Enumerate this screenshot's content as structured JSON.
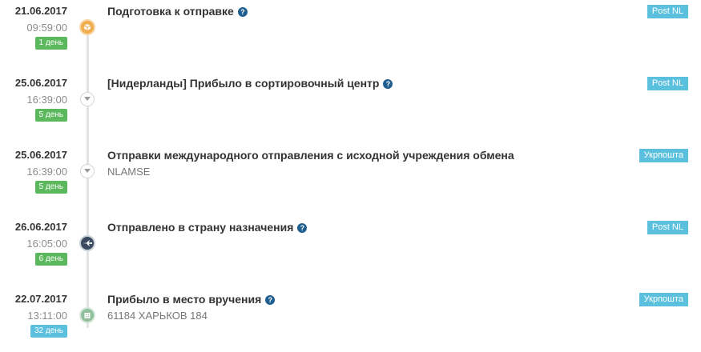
{
  "events": [
    {
      "date": "21.06.2017",
      "time": "09:59:00",
      "days": "1 день",
      "title": "Подготовка к отправке",
      "subtitle": "",
      "carrier": "Post NL",
      "icon": "package-icon",
      "has_help": true
    },
    {
      "date": "25.06.2017",
      "time": "16:39:00",
      "days": "5 день",
      "title": "[Нидерланды] Прибыло в сортировочный центр",
      "subtitle": "",
      "carrier": "Post NL",
      "icon": "chevron-down-icon",
      "has_help": true
    },
    {
      "date": "25.06.2017",
      "time": "16:39:00",
      "days": "5 день",
      "title": "Отправки международного отправления с исходной учреждения обмена",
      "subtitle": "NLAMSE",
      "carrier": "Укрпошта",
      "icon": "chevron-down-icon",
      "has_help": false
    },
    {
      "date": "26.06.2017",
      "time": "16:05:00",
      "days": "6 день",
      "title": "Отправлено в страну назначения",
      "subtitle": "",
      "carrier": "Post NL",
      "icon": "airplane-icon",
      "has_help": true
    },
    {
      "date": "22.07.2017",
      "time": "13:11:00",
      "days": "32 день",
      "title": "Прибыло в место вручения",
      "subtitle": "61184 ХАРЬКОВ 184",
      "carrier": "Укрпошта",
      "icon": "building-icon",
      "has_help": true
    }
  ],
  "colors": {
    "days_green": "#5cb85c",
    "days_blue": "#5bc0de",
    "carrier": "#5bc0de",
    "help": "#1f5f8f"
  }
}
